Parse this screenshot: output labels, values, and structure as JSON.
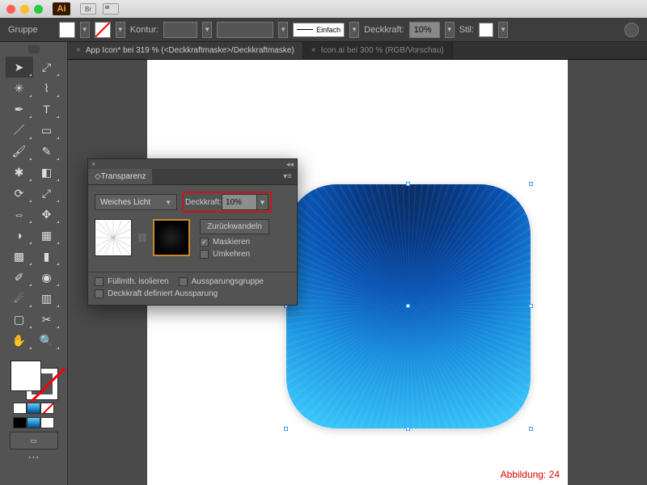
{
  "ctrl": {
    "group": "Gruppe",
    "kontur": "Kontur:",
    "einfach": "Einfach",
    "deckkraft_label": "Deckkraft:",
    "deckkraft_value": "10%",
    "stil": "Stil:"
  },
  "tabs": {
    "t0": "App Icon* bei 319 % (<Deckkraftmaske>/Deckkraftmaske)",
    "t1": "Icon.ai bei 300 % (RGB/Vorschau)"
  },
  "panel": {
    "title": "Transparenz",
    "mode": "Weiches Licht",
    "deck_label": "Deckkraft:",
    "deck_value": "10%",
    "btn_revert": "Zurückwandeln",
    "chk_mask": "Maskieren",
    "chk_invert": "Umkehren",
    "chk_isolate": "Füllmth. isolieren",
    "chk_knockout": "Aussparungsgruppe",
    "chk_define": "Deckkraft definiert Aussparung"
  },
  "caption": "Abbildung: 24",
  "tooltips": {
    "br": "Br"
  }
}
